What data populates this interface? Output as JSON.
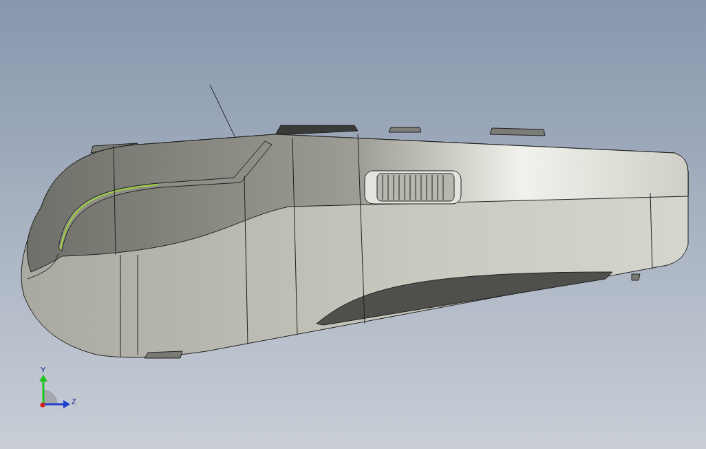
{
  "triad": {
    "axes": [
      {
        "label": "Y"
      },
      {
        "label": "Z"
      }
    ]
  }
}
